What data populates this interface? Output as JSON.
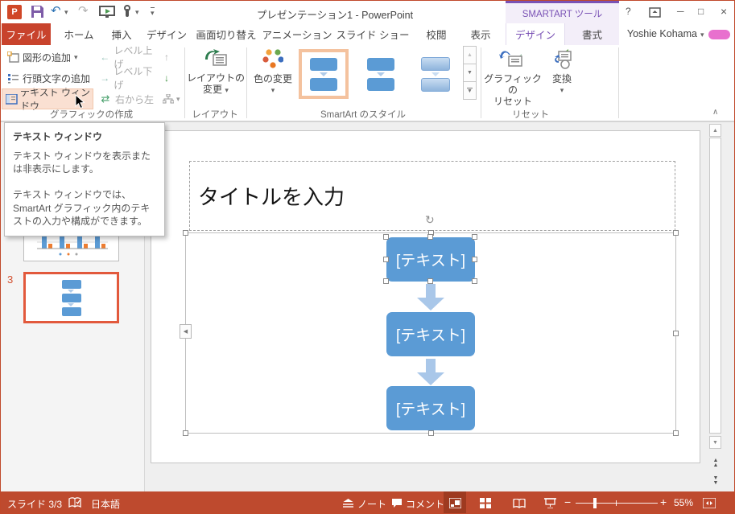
{
  "titlebar": {
    "title": "プレゼンテーション1 - PowerPoint",
    "contextual_label": "SMARTART ツール",
    "user_name": "Yoshie Kohama"
  },
  "tabs": {
    "file": "ファイル",
    "home": "ホーム",
    "insert": "挿入",
    "design": "デザイン",
    "transitions": "画面切り替え",
    "animations": "アニメーション",
    "slideshow": "スライド ショー",
    "review": "校閲",
    "view": "表示",
    "smartart_design": "デザイン",
    "smartart_format": "書式"
  },
  "ribbon": {
    "create_graphic": {
      "label": "グラフィックの作成",
      "add_shape": "図形の追加",
      "add_bullet": "行頭文字の追加",
      "text_pane": "テキスト ウィンドウ",
      "promote": "レベル上げ",
      "demote": "レベル下げ",
      "right_to_left": "右から左"
    },
    "layouts": {
      "label": "レイアウト",
      "change_layout_line1": "レイアウトの",
      "change_layout_line2": "変更"
    },
    "styles": {
      "label": "SmartArt のスタイル",
      "change_colors": "色の変更"
    },
    "reset": {
      "label": "リセット",
      "reset_graphic_line1": "グラフィックの",
      "reset_graphic_line2": "リセット",
      "convert": "変換"
    }
  },
  "tooltip": {
    "title": "テキスト ウィンドウ",
    "paragraph1": "テキスト ウィンドウを表示または非表示にします。",
    "paragraph2": "テキスト ウィンドウでは、SmartArt グラフィック内のテキストの入力や構成ができます。"
  },
  "slide_panel": {
    "selected_slide_number": "3"
  },
  "slide": {
    "title_placeholder": "タイトルを入力",
    "smartart": {
      "node1": "[テキスト]",
      "node2": "[テキスト]",
      "node3": "[テキスト]"
    }
  },
  "statusbar": {
    "slide_indicator": "スライド 3/3",
    "language": "日本語",
    "notes": "ノート",
    "comments": "コメント",
    "zoom_level": "55%"
  },
  "icons": {
    "app_letter": "P",
    "dropdown": "▾",
    "undo": "↶",
    "redo": "↷",
    "promote": "←",
    "demote": "→",
    "right_to_left": "⇄",
    "move_up": "↑",
    "move_down": "↓",
    "tri_up": "▲",
    "tri_down": "▼",
    "help": "?",
    "minimize": "─",
    "maximize": "□",
    "close": "×",
    "collapse_ribbon": "∧",
    "left_pane_tab": "◀",
    "rotation": "↻",
    "zoom_out": "−",
    "zoom_in": "+"
  },
  "colors": {
    "accent_red": "#C0492B",
    "contextual_purple": "#7A52B5",
    "smartart_blue": "#5B9BD5",
    "flow_arrow_blue": "#A9C7E9",
    "thumbnail_selection": "#E2593C",
    "hover_highlight": "#FAE0D2"
  }
}
